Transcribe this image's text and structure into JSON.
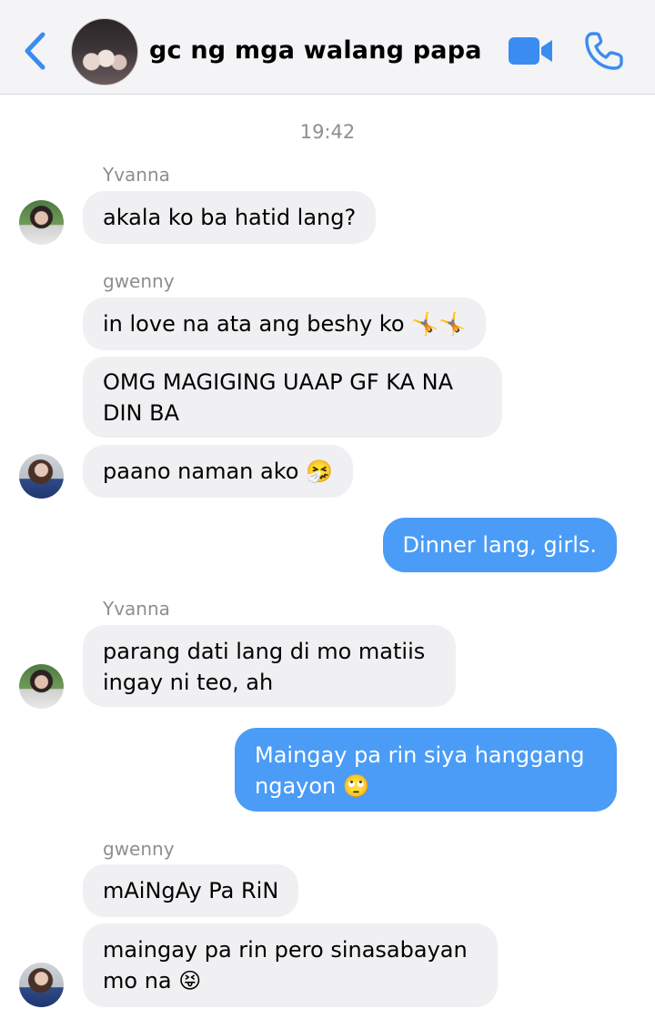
{
  "header": {
    "title": "gc ng mga walang papa",
    "accent": "#3b8cf0"
  },
  "timestamp": "19:42",
  "messages": [
    {
      "sender": "Yvanna",
      "text": "akala ko ba hatid lang?"
    },
    {
      "sender": "gwenny",
      "text": "in love na ata ang beshy ko 🤸🤸"
    },
    {
      "text": "OMG MAGIGING UAAP GF KA NA\nDIN BA"
    },
    {
      "text": "paano naman ako 🤧"
    },
    {
      "outgoing": true,
      "text": "Dinner lang, girls."
    },
    {
      "sender": "Yvanna",
      "text": "parang dati lang di mo matiis\ningay ni teo, ah"
    },
    {
      "outgoing": true,
      "text": "Maingay pa rin siya hanggang\nngayon 🙄"
    },
    {
      "sender": "gwenny",
      "text": "mAiNgAy Pa RiN"
    },
    {
      "text": "maingay pa rin pero sinasabayan\nmo na 😝"
    }
  ],
  "colors": {
    "outgoing_bubble": "#4a9cf6",
    "incoming_bubble": "#f0f0f2",
    "meta_text": "#8e8e93"
  },
  "icons": [
    "back-chevron-icon",
    "video-call-icon",
    "phone-call-icon"
  ]
}
